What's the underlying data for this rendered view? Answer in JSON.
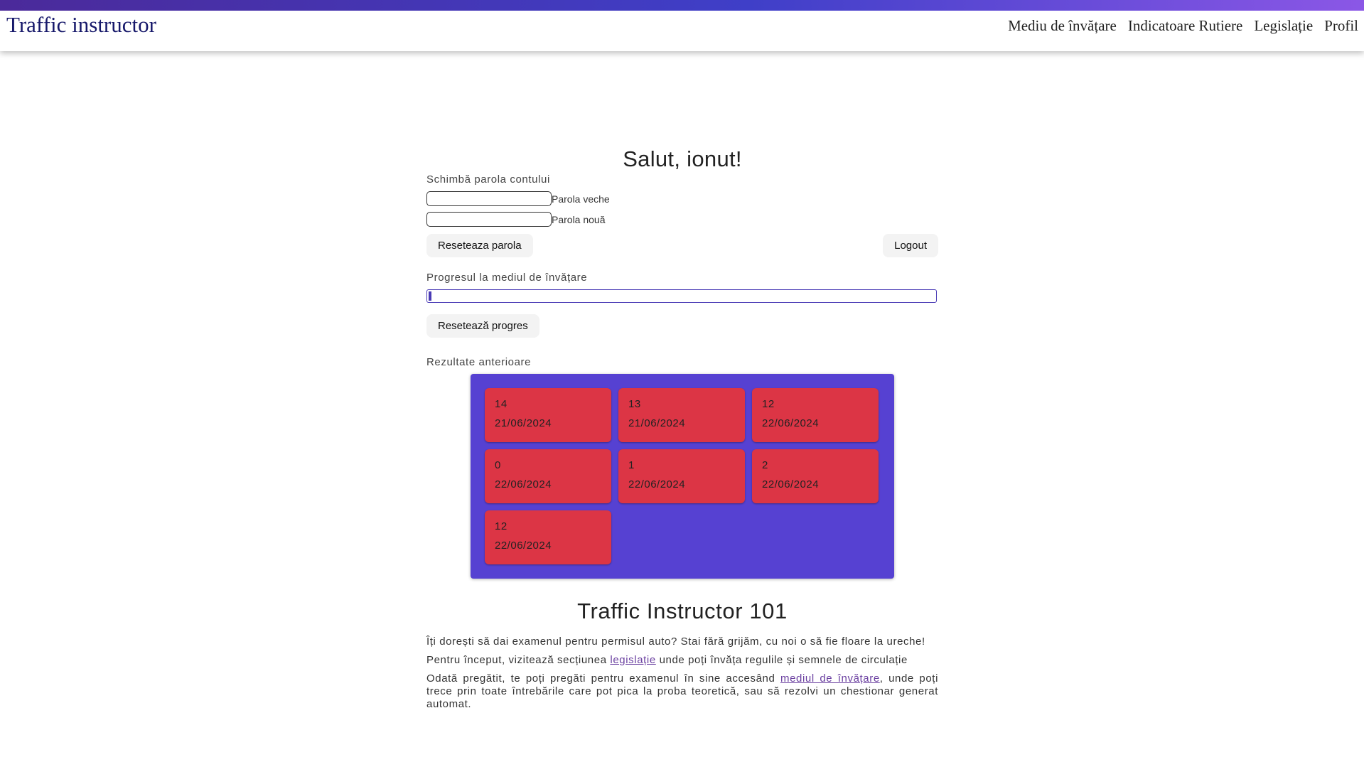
{
  "header": {
    "brand": "Traffic instructor",
    "nav": [
      {
        "label": "Mediu de învățare"
      },
      {
        "label": "Indicatoare Rutiere"
      },
      {
        "label": "Legislație"
      },
      {
        "label": "Profil"
      }
    ]
  },
  "profile": {
    "greeting": "Salut, ionut!",
    "change_password_label": "Schimbă parola contului",
    "old_password_label": "Parola veche",
    "new_password_label": "Parola nouă",
    "old_password_value": "",
    "new_password_value": "",
    "reset_password_button": "Reseteaza parola",
    "logout_button": "Logout",
    "progress_label": "Progresul la mediul de învățare",
    "progress_fraction": 0.005,
    "reset_progress_button": "Resetează progres",
    "results_label": "Rezultate anterioare",
    "results": [
      {
        "score": "14",
        "date": "21/06/2024"
      },
      {
        "score": "13",
        "date": "21/06/2024"
      },
      {
        "score": "12",
        "date": "22/06/2024"
      },
      {
        "score": "0",
        "date": "22/06/2024"
      },
      {
        "score": "1",
        "date": "22/06/2024"
      },
      {
        "score": "2",
        "date": "22/06/2024"
      },
      {
        "score": "12",
        "date": "22/06/2024"
      }
    ]
  },
  "about": {
    "title": "Traffic Instructor 101",
    "p1": "Îți dorești să dai examenul pentru permisul auto? Stai fără grijăm, cu noi o să fie floare la ureche!",
    "p2_before": "Pentru început, vizitează secțiunea ",
    "p2_link": "legislație",
    "p2_after": " unde poți învăța regulile și semnele de circulație",
    "p3_before": "Odată pregătit, te poți pregăti pentru examenul în sine accesând ",
    "p3_link": "mediul de învățare",
    "p3_after": ", unde poți trece prin toate întrebările care pot pica la proba teoretică, sau să rezolvi un chestionar generat automat."
  },
  "colors": {
    "header_gradient_start": "#4b2a9a",
    "header_gradient_end": "#8b57e6",
    "brand_text": "#16186a",
    "results_panel": "#5641d2",
    "result_card": "#dc3545",
    "link": "#6a3fa0"
  }
}
